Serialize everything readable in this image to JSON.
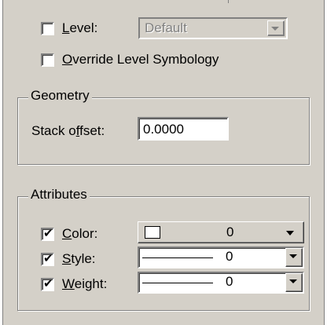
{
  "level": {
    "checkbox_checked": false,
    "label_prefix": "L",
    "label_rest": "evel:",
    "combo_value": "Default"
  },
  "override": {
    "checkbox_checked": false,
    "label_prefix": "O",
    "label_rest": "verride Level Symbology"
  },
  "geometry": {
    "title": "Geometry",
    "stack_offset_label_a": "Stack o",
    "stack_offset_label_u": "f",
    "stack_offset_label_b": "fset:",
    "stack_offset_value": "0.0000"
  },
  "attributes": {
    "title": "Attributes",
    "color": {
      "checked": true,
      "label_prefix": "C",
      "label_rest": "olor:",
      "value": "0",
      "swatch_color": "#ffffff"
    },
    "style": {
      "checked": true,
      "label_prefix": "S",
      "label_rest": "tyle:",
      "value": "0"
    },
    "weight": {
      "checked": true,
      "label_prefix": "W",
      "label_rest": "eight:",
      "value": "0"
    }
  },
  "icons": {
    "checkmark": "✔",
    "dropdown": "chevron-down-icon"
  }
}
